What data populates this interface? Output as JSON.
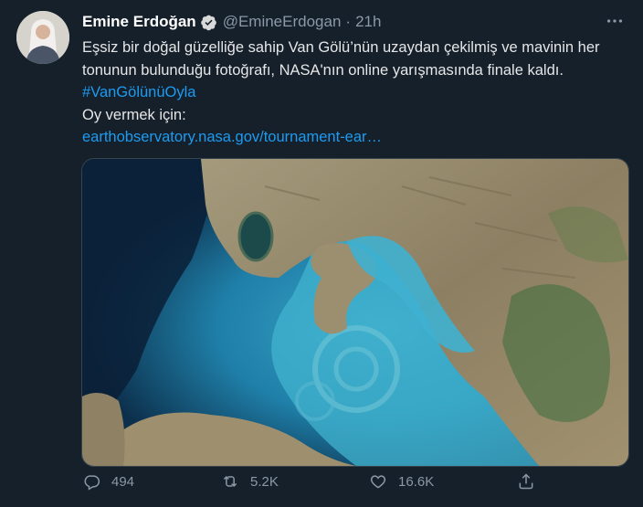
{
  "author": {
    "name": "Emine Erdoğan",
    "handle": "@EmineErdogan",
    "time": "21h"
  },
  "tweet": {
    "line1": "Eşsiz bir doğal güzelliğe sahip Van Gölü’nün uzaydan çekilmiş ve mavinin her tonunun bulunduğu fotoğrafı, NASA'nın online yarışmasında finale kaldı.",
    "hashtag": "#VanGölünüOyla",
    "line2": "Oy vermek için:",
    "link": "earthobservatory.nasa.gov/tournament-ear…"
  },
  "actions": {
    "replies": "494",
    "retweets": "5.2K",
    "likes": "16.6K"
  },
  "icons": [
    "verified-badge-icon",
    "more-icon",
    "reply-icon",
    "retweet-icon",
    "like-icon",
    "share-icon"
  ],
  "colors": {
    "background": "#15202b",
    "link": "#1d9bf0",
    "secondary": "#8b98a5"
  }
}
